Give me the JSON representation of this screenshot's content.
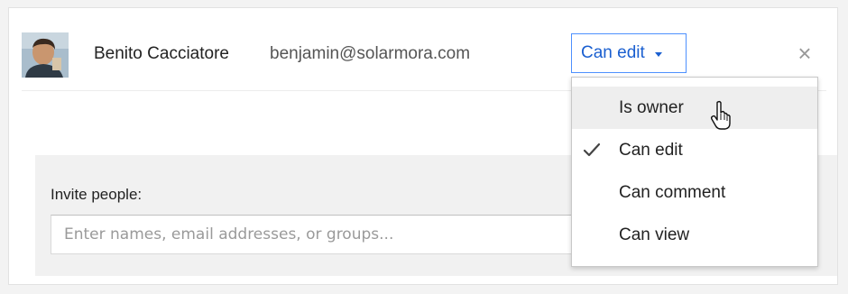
{
  "collaborator": {
    "name": "Benito Cacciatore",
    "email": "benjamin@solarmora.com",
    "permission": "Can edit",
    "avatar_icon": "user-photo-avatar",
    "remove_icon": "close-icon",
    "remove_symbol": "×"
  },
  "permission_menu": {
    "items": [
      {
        "label": "Is owner",
        "state": "hovered"
      },
      {
        "label": "Can edit",
        "state": "selected"
      },
      {
        "label": "Can comment",
        "state": "normal"
      },
      {
        "label": "Can view",
        "state": "normal"
      }
    ],
    "check_icon": "checkmark-icon"
  },
  "invite": {
    "label": "Invite people:",
    "placeholder": "Enter names, email addresses, or groups..."
  },
  "pointer": {
    "icon": "hand-pointer-cursor-icon"
  },
  "colors": {
    "accent": "#4d90fe",
    "link_text": "#1a5fd0",
    "menu_hover": "#eeeeee",
    "panel_bg": "#f1f1f1"
  }
}
